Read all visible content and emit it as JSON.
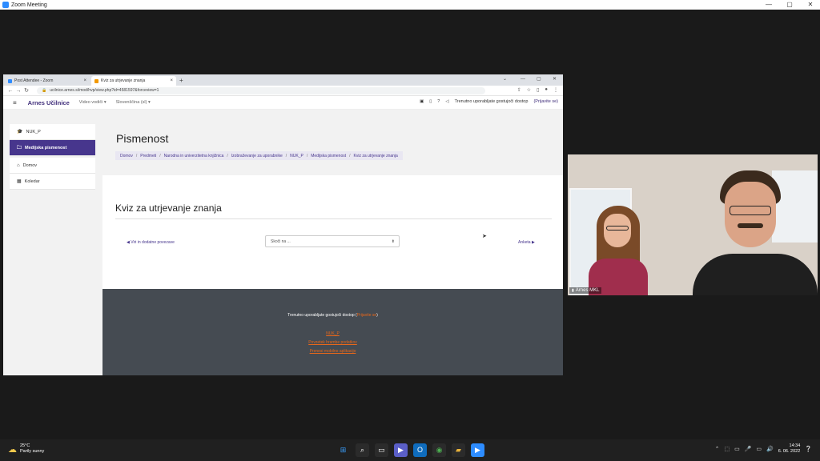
{
  "zoom": {
    "title": "Zoom Meeting",
    "min": "—",
    "max": "▢",
    "close": "✕"
  },
  "browser": {
    "tabs": [
      {
        "label": "Post Attendee - Zoom",
        "close": "×",
        "color": "#2d8cff"
      },
      {
        "label": "Kviz za utrjevanje znanja",
        "close": "×",
        "color": "#f29900"
      }
    ],
    "new_tab": "+",
    "tab_ctl": [
      "⌄",
      "—",
      "▢",
      "✕"
    ],
    "url": "ucilnice.arnes.si/mod/hvp/view.php?id=4581597&forceview=1",
    "url_icons": [
      "⇪",
      "☆",
      "▯",
      "●",
      "⋮"
    ]
  },
  "moodle": {
    "brand": "Arnes Učilnice",
    "nav1": "Video vodiči ▾",
    "nav2": "Slovenščina (sl) ▾",
    "guest_text": "Trenutno uporabljate gostujoči dostop",
    "login_link": "(Prijavite se)",
    "nav_icons": [
      "▣",
      "▯",
      "?",
      "◁"
    ]
  },
  "sidebar": {
    "items": [
      {
        "icon": "🎓",
        "label": "NUK_P"
      },
      {
        "icon": "🗀",
        "label": "Medijska pismenost"
      },
      {
        "icon": "⌂",
        "label": "Domov"
      },
      {
        "icon": "▦",
        "label": "Koledar"
      }
    ]
  },
  "header": {
    "title": "Pismenost",
    "breadcrumb": [
      "Domov",
      "Predmeti",
      "Narodna in univerzitetna knjižnica",
      "Izobraževanje za uporabnike",
      "NUK_P",
      "Medijska pismenost",
      "Kviz za utrjevanje znanja"
    ]
  },
  "main": {
    "quiz_title": "Kviz za utrjevanje znanja",
    "prev_link": "◀ Viri in dodatne povezave",
    "jump_placeholder": "Skoči na ...",
    "jump_arrow": "⬍",
    "next_link": "Anketa ▶"
  },
  "footer": {
    "guest_text": "Trenutno uporabljate gostujoči dostop (",
    "login_link": "Prijavite se",
    "guest_close": ")",
    "links": [
      "NUK_P",
      "Povzetek hrambe podatkov",
      "Prenesi mobilno aplikacijo"
    ]
  },
  "video": {
    "participant": "Arnes MKL"
  },
  "taskbar": {
    "temp": "25°C",
    "weather": "Partly sunny",
    "time": "14:34",
    "date": "6. 06. 2022",
    "apps": [
      {
        "glyph": "⊞",
        "color": "#3aa0ff"
      },
      {
        "glyph": "⌕",
        "color": "#2b2b2b"
      },
      {
        "glyph": "▭",
        "color": "#2b2b2b"
      },
      {
        "glyph": "▶",
        "color": "#5b5fc7"
      },
      {
        "glyph": "O",
        "color": "#0f6cbd"
      },
      {
        "glyph": "◉",
        "color": "#2b2b2b"
      },
      {
        "glyph": "▰",
        "color": "#e8b23a"
      },
      {
        "glyph": "▶",
        "color": "#2d8cff"
      }
    ],
    "tray": [
      "⌃",
      "⬚",
      "▭",
      "🎤",
      "▭",
      "🔊"
    ]
  }
}
